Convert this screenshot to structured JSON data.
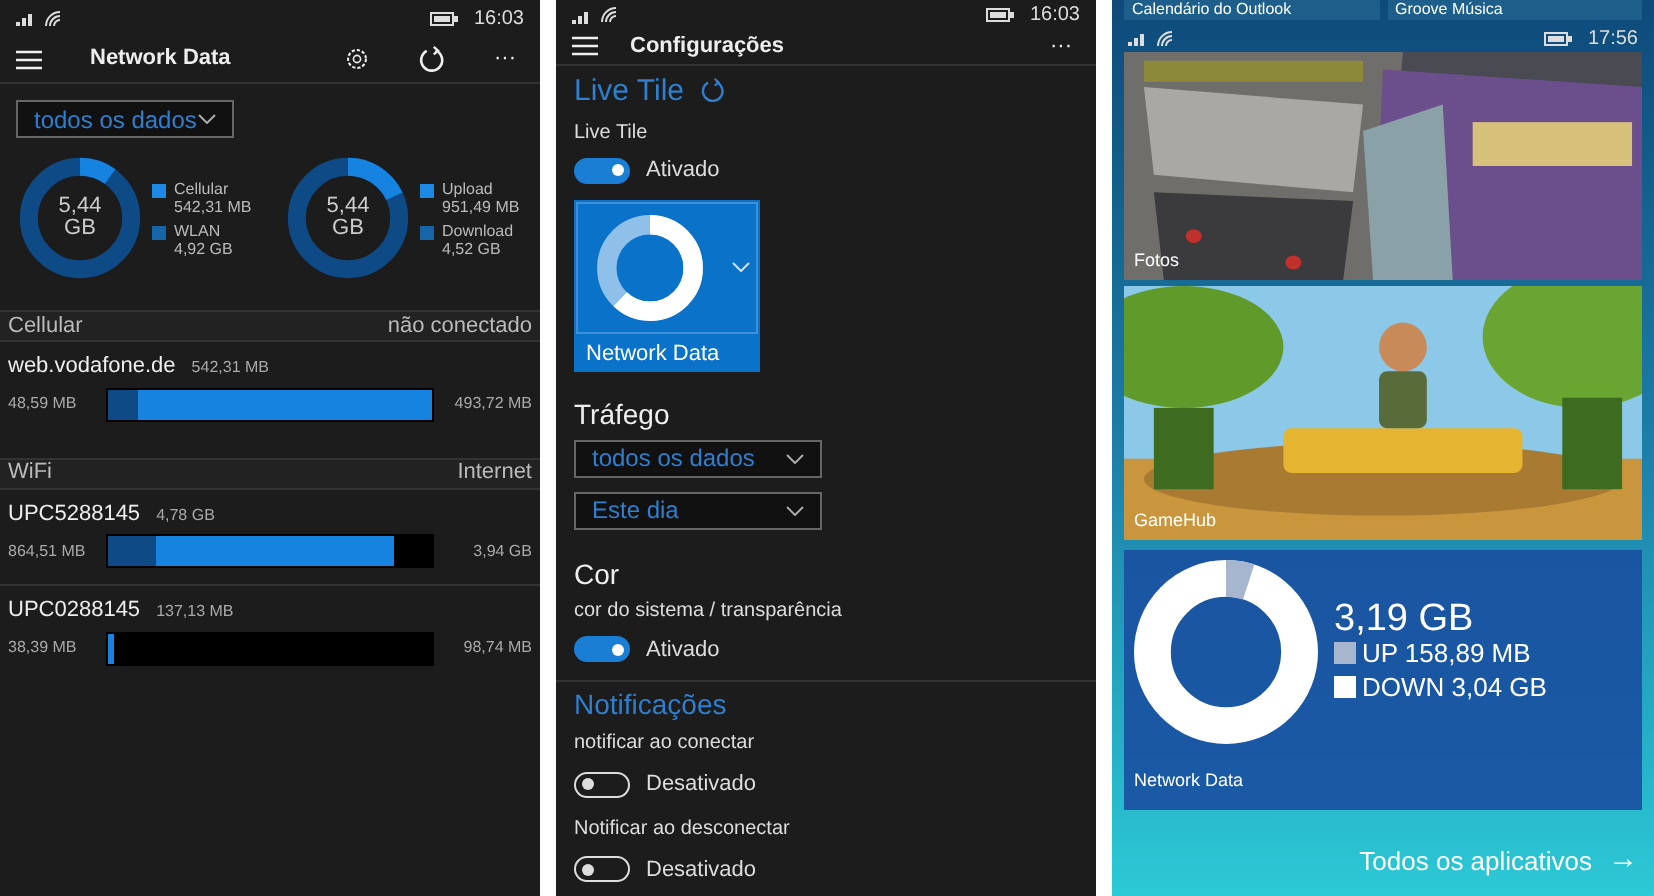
{
  "network_screen": {
    "status_bar": {
      "time": "16:03"
    },
    "title": "Network Data",
    "more": "···",
    "filter": {
      "value": "todos os dados"
    },
    "donuts": [
      {
        "total": "5,44",
        "unit": "GB",
        "legend": [
          {
            "label": "Cellular",
            "value": "542,31 MB",
            "color": "#1e88e5"
          },
          {
            "label": "WLAN",
            "value": "4,92 GB",
            "color": "#1565a8"
          }
        ]
      },
      {
        "total": "5,44",
        "unit": "GB",
        "legend": [
          {
            "label": "Upload",
            "value": "951,49 MB",
            "color": "#1e88e5"
          },
          {
            "label": "Download",
            "value": "4,52 GB",
            "color": "#1565a8"
          }
        ]
      }
    ],
    "sections": [
      {
        "name": "Cellular",
        "status": "não conectado",
        "networks": [
          {
            "name": "web.vodafone.de",
            "total": "542,31 MB",
            "left": "48,59 MB",
            "right": "493,72 MB",
            "segments": [
              {
                "level": 0.09,
                "color": "#0e4a85"
              },
              {
                "level": 1,
                "color": "#1683e0"
              }
            ]
          }
        ]
      },
      {
        "name": "WiFi",
        "status": "Internet",
        "networks": [
          {
            "name": "UPC5288145",
            "total": "4,78 GB",
            "left": "864,51 MB",
            "right": "3,94 GB",
            "segments": [
              {
                "level": 0.15,
                "color": "#0e4a85"
              },
              {
                "level": 0.88,
                "color": "#1683e0"
              }
            ]
          },
          {
            "name": "UPC0288145",
            "total": "137,13 MB",
            "left": "38,39 MB",
            "right": "98,74 MB",
            "segments": [
              {
                "level": 0.02,
                "color": "#1683e0"
              }
            ]
          }
        ]
      }
    ]
  },
  "settings_screen": {
    "status_bar": {
      "time": "16:03"
    },
    "title": "Configurações",
    "more": "···",
    "live_tile": {
      "heading": "Live Tile",
      "label": "Live Tile",
      "toggle": {
        "on": true,
        "text": "Ativado"
      },
      "tile_name": "Network Data"
    },
    "traffic": {
      "heading": "Tráfego",
      "dropdowns": [
        {
          "value": "todos os dados"
        },
        {
          "value": "Este dia"
        }
      ]
    },
    "color": {
      "heading": "Cor",
      "label": "cor do sistema / transparência",
      "toggle": {
        "on": true,
        "text": "Ativado"
      }
    },
    "notifications": {
      "heading": "Notificações",
      "items": [
        {
          "label": "notificar ao conectar",
          "toggle": {
            "on": false,
            "text": "Desativado"
          }
        },
        {
          "label": "Notificar ao desconectar",
          "toggle": {
            "on": false,
            "text": "Desativado"
          }
        }
      ]
    }
  },
  "start_screen": {
    "status_bar": {
      "time": "17:56"
    },
    "top_tiles": [
      {
        "label": "Calendário do Outlook"
      },
      {
        "label": "Groove Música"
      }
    ],
    "tiles": [
      {
        "kind": "photos",
        "label": "Fotos"
      },
      {
        "kind": "game",
        "label": "GameHub"
      },
      {
        "kind": "data",
        "label": "Network Data",
        "total": "3,19 GB",
        "up": "UP 158,89 MB",
        "down": "DOWN 3,04 GB"
      }
    ],
    "all_apps": "Todos os aplicativos",
    "all_apps_arrow": "→"
  }
}
